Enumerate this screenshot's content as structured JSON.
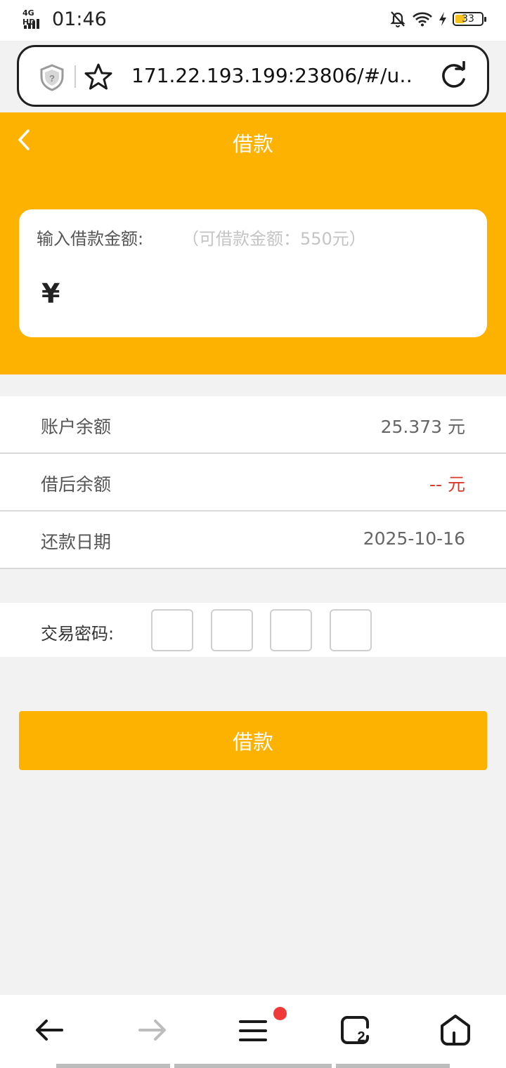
{
  "status_bar": {
    "network": "4G HD",
    "time": "01:46",
    "battery": "33"
  },
  "browser": {
    "url": "171.22.193.199:23806/#/u…"
  },
  "header": {
    "title": "借款"
  },
  "amount_card": {
    "label": "输入借款金额:",
    "hint": "（可借款金额：550元）",
    "currency": "¥",
    "value": ""
  },
  "info": {
    "balance_label": "账户余额",
    "balance_value": "25.373 元",
    "after_label": "借后余额",
    "after_value": "-- 元",
    "due_label": "还款日期",
    "due_value": "2025-10-16"
  },
  "password": {
    "label": "交易密码:"
  },
  "submit_label": "借款",
  "bottom_nav": {
    "tab_count": "2"
  },
  "colors": {
    "brand": "#fdb100",
    "negative": "#d93a2b",
    "badge": "#f03a3a"
  }
}
